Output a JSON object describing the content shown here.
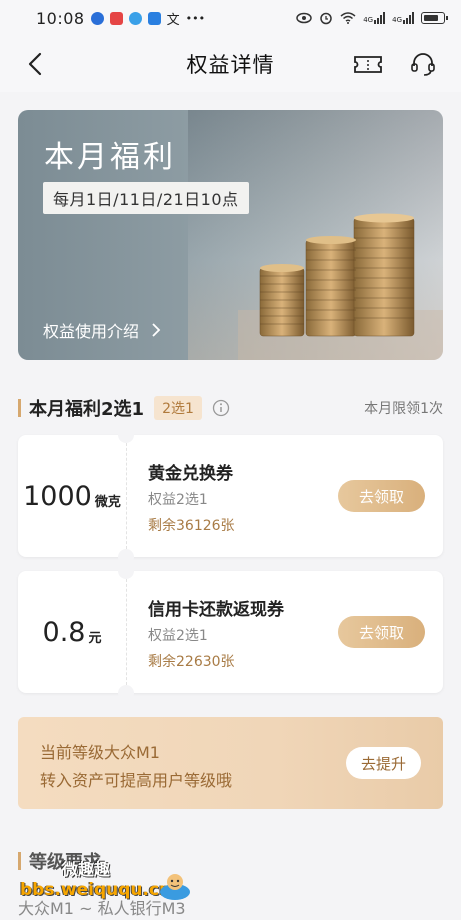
{
  "status_bar": {
    "time": "10:08",
    "extra": "•••",
    "net_a": "4G",
    "net_b": "4G"
  },
  "nav": {
    "title": "权益详情"
  },
  "hero": {
    "title": "本月福利",
    "schedule": "每月1日/11日/21日10点",
    "link_label": "权益使用介绍"
  },
  "section": {
    "title": "本月福利2选1",
    "badge": "2选1",
    "limit": "本月限领1次"
  },
  "coupons": [
    {
      "amount": "1000",
      "unit": "微克",
      "name": "黄金兑换券",
      "tag": "权益2选1",
      "remain": "剩余36126张",
      "button": "去领取"
    },
    {
      "amount": "0.8",
      "unit": "元",
      "name": "信用卡还款返现券",
      "tag": "权益2选1",
      "remain": "剩余22630张",
      "button": "去领取"
    }
  ],
  "level": {
    "line1": "当前等级大众M1",
    "line2": "转入资产可提高用户等级哦",
    "button": "去提升"
  },
  "requirements": {
    "title": "等级要求",
    "range": "大众M1 ~ 私人银行M3"
  },
  "watermark": {
    "cn": "微趣趣",
    "url": "bbs.weiququ.cn"
  },
  "colors": {
    "accent": "#d9b07c",
    "gold_text": "#a87b45",
    "page_bg": "#f4f4f6"
  },
  "icons": {
    "back": "chevron-left-icon",
    "ticket": "ticket-icon",
    "support": "headset-icon",
    "info": "info-icon",
    "arrow": "chevron-right-icon"
  }
}
